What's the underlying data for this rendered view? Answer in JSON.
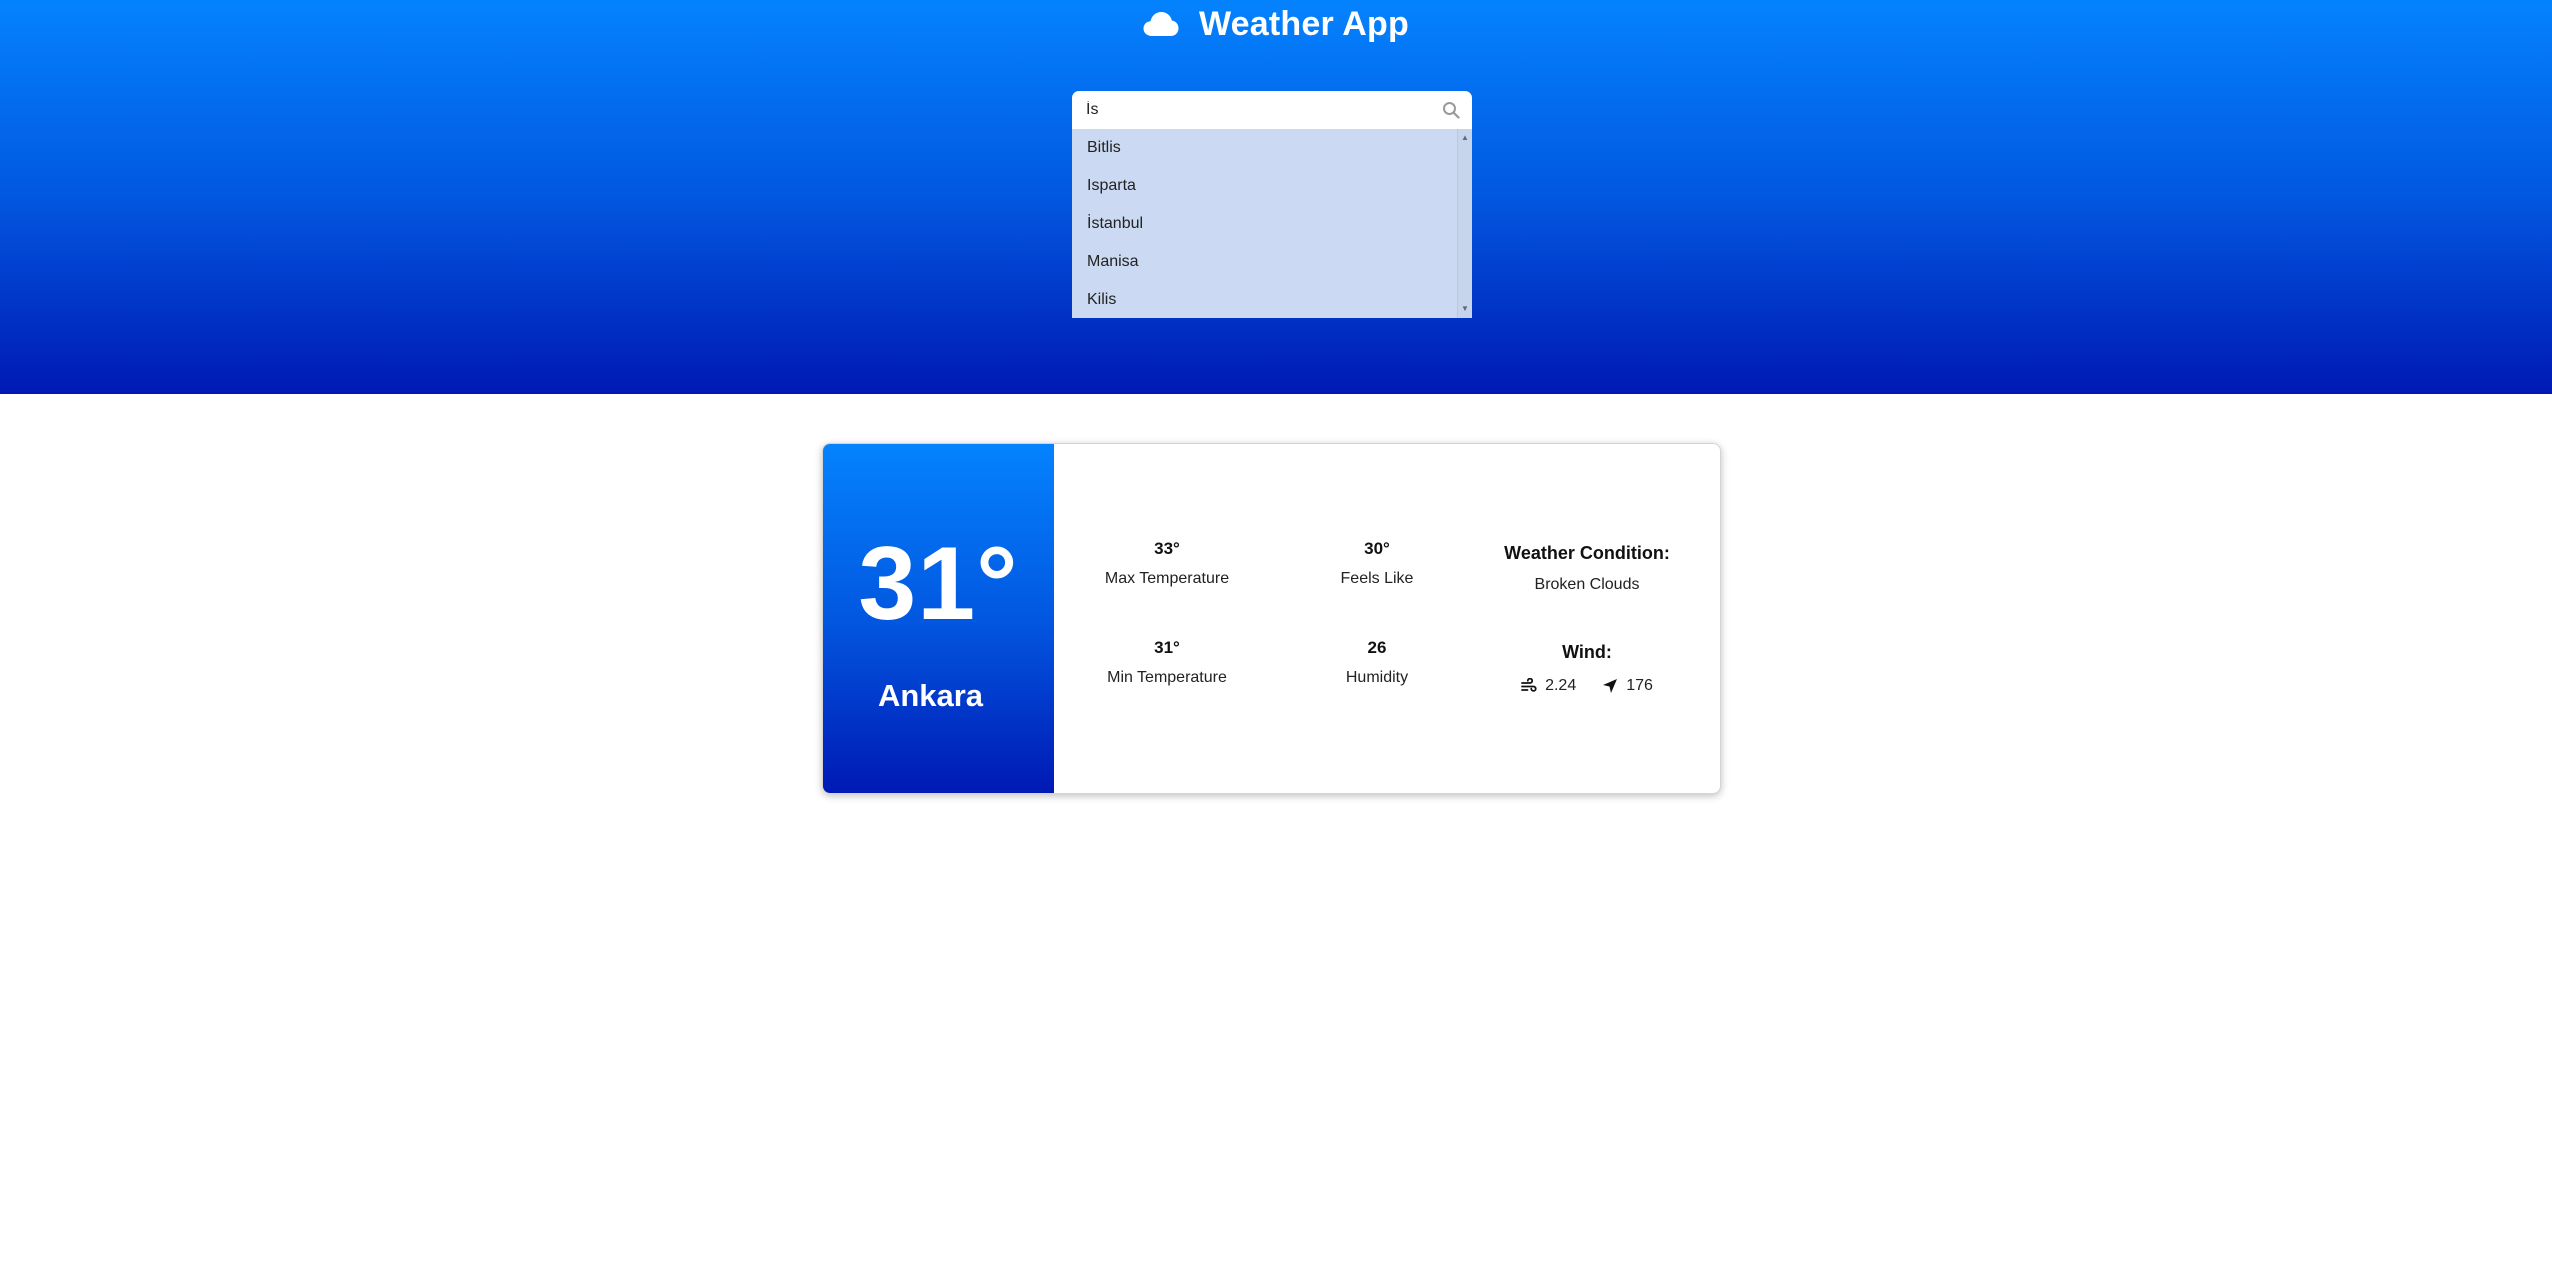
{
  "app": {
    "title": "Weather App",
    "icon": "cloud-icon"
  },
  "search": {
    "value": "İs",
    "icon": "search-icon",
    "suggestions": [
      "Bitlis",
      "Isparta",
      "İstanbul",
      "Manisa",
      "Kilis"
    ]
  },
  "weather": {
    "temperature": "31°",
    "city": "Ankara",
    "max_temp": {
      "value": "33°",
      "label": "Max Temperature"
    },
    "feels_like": {
      "value": "30°",
      "label": "Feels Like"
    },
    "min_temp": {
      "value": "31°",
      "label": "Min Temperature"
    },
    "humidity": {
      "value": "26",
      "label": "Humidity"
    },
    "condition": {
      "heading": "Weather Condition:",
      "text": "Broken Clouds"
    },
    "wind": {
      "heading": "Wind:",
      "speed": "2.24",
      "direction": "176"
    }
  },
  "colors": {
    "gradient_top": "#0483fe",
    "gradient_bottom": "#0019b5",
    "dropdown_bg": "#cbdaf2"
  }
}
